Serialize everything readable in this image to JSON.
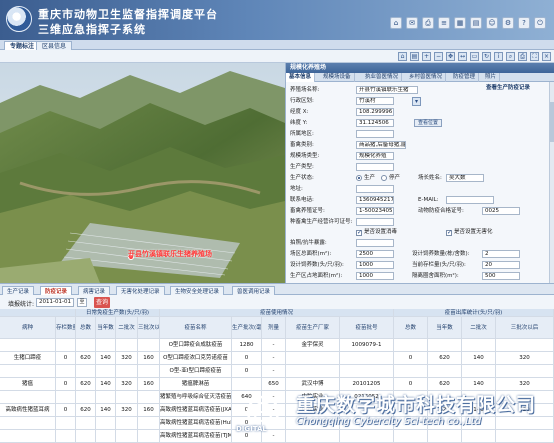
{
  "header": {
    "title_line1": "重庆市动物卫生监督指挥调度平台",
    "title_line2": "三维应急指挥子系统"
  },
  "tabs": [
    "专题标注",
    "区县信息"
  ],
  "panel": {
    "title": "规模化养殖场",
    "tabs": [
      "基本信息",
      "规模场设备",
      "执业兽医情况",
      "乡村兽医情况",
      "防疫管理",
      "照片"
    ],
    "link": "查看生产防疫记录",
    "fields": {
      "name_label": "养殖场名称:",
      "name_value": "开县竹溪镇联乐生猪",
      "village_label": "行政区划:",
      "village_value": "竹溪村",
      "lon_label": "经度 X:",
      "lon_value": "108.299996",
      "lat_label": "纬度 Y:",
      "lat_value": "31.124506",
      "town_label": "所属地区:",
      "town_value": "",
      "animal_label": "畜禽类别:",
      "animal_value": "商品猪,后备母猪,能",
      "scale_label": "规模场类型:",
      "scale_value": "规模化养殖",
      "prod_label": "生产类型:",
      "prod_value": "",
      "state_label": "生产状态:",
      "state_opt1": "生产",
      "state_opt2": "停产",
      "owner_label": "场长姓名:",
      "owner_value": "吴大数",
      "addr_label": "地址:",
      "addr_value": "",
      "phone_label": "联系电话:",
      "phone_value": "13609452175",
      "email_label": "E-MAIL:",
      "email_value": "",
      "license_label": "畜禽养殖证号:",
      "license_value": "1-5002340519",
      "permit_label": "动物防疫合格证号:",
      "permit_value": "0025",
      "sanitize_label": "种畜禽生产经营许可证号:",
      "sanitize_value": "",
      "chk1": "是否设置消毒",
      "chk2": "是否设置无害化",
      "direct_label": "拍照/抗牛暴露:",
      "direct_value": "",
      "area_label": "场区总面积(m²):",
      "area_value": "2500",
      "design_label": "设计饲养数量(栋/舍数):",
      "design_value": "2",
      "cap_label": "设计饲养数(头/只/羽):",
      "cap_value": "1000",
      "stock_label": "当前存栏量(头/只/羽):",
      "stock_value": "20",
      "bld_label": "生产区占地面积(m²):",
      "bld_value": "1000",
      "iso_label": "隔离圈舍面积(m²):",
      "iso_value": "500",
      "btn_locate": "查看位置"
    }
  },
  "map": {
    "label": "开县竹溪镇联乐生猪养殖场"
  },
  "lower_tabs": [
    "生产记录",
    "防疫记录",
    "病害记录",
    "无害化处理记录",
    "生物安全处理记录",
    "兽医调用记录"
  ],
  "filter": {
    "label": "填报统计:",
    "date": "2011-01-01",
    "select": "至",
    "button": "查询"
  },
  "table": {
    "group_headers": [
      "日常免疫生产数(头/只/羽)",
      "疫苗使用情况",
      "疫苗出库统计(头/只/羽)"
    ],
    "headers": [
      "病种",
      "存栏数量(头/只/羽)",
      "总数",
      "当年数",
      "二批次",
      "三批次以后",
      "疫苗名称",
      "生产批次(毫升)",
      "剂量",
      "疫苗生产厂家",
      "疫苗批号",
      "总数",
      "当年数",
      "二批次",
      "三批次以后"
    ],
    "rows": [
      {
        "disease": "",
        "stock": "",
        "total": "",
        "y1": "",
        "b2": "",
        "b3": "",
        "vaccine": "O型口蹄疫合成肽疫苗",
        "batch": "1280",
        "dose": "-",
        "maker": "金宇保灵",
        "lot": "1009079-1",
        "o1": "",
        "o2": "",
        "o3": "",
        "o4": ""
      },
      {
        "disease": "生猪口蹄疫",
        "stock": "0",
        "total": "620",
        "y1": "140",
        "b2": "320",
        "b3": "160",
        "vaccine": "O型口蹄疫浓口克劳诺疫苗",
        "batch": "0",
        "dose": "-",
        "maker": "",
        "lot": "",
        "o1": "0",
        "o2": "620",
        "o3": "140",
        "o4": "320"
      },
      {
        "disease": "",
        "stock": "",
        "total": "",
        "y1": "",
        "b2": "",
        "b3": "",
        "vaccine": "O型-亚I型口蹄疫疫苗",
        "batch": "0",
        "dose": "-",
        "maker": "",
        "lot": "",
        "o1": "",
        "o2": "",
        "o3": "",
        "o4": ""
      },
      {
        "disease": "猪瘟",
        "stock": "0",
        "total": "620",
        "y1": "140",
        "b2": "320",
        "b3": "160",
        "vaccine": "猪瘟脾淋苗",
        "batch": "",
        "dose": "650",
        "maker": "武汉中博",
        "lot": "20101205",
        "o1": "0",
        "o2": "620",
        "o3": "140",
        "o4": "320"
      },
      {
        "disease": "",
        "stock": "",
        "total": "",
        "y1": "",
        "b2": "",
        "b3": "",
        "vaccine": "猪繁殖与呼吸综合征灭活疫苗(NVDC-JXA1株)",
        "batch": "640",
        "dose": "-",
        "maker": "中牧实业",
        "lot": "0216052",
        "o1": "",
        "o2": "",
        "o3": "",
        "o4": ""
      },
      {
        "disease": "高致病性猪蓝耳病",
        "stock": "0",
        "total": "620",
        "y1": "140",
        "b2": "320",
        "b3": "160",
        "vaccine": "高致病性猪蓝耳病活疫苗(JXA1-R株)",
        "batch": "0",
        "dose": "-",
        "maker": "中牧实业",
        "lot": "",
        "o1": "0",
        "o2": "620",
        "o3": "140",
        "o4": "320"
      },
      {
        "disease": "",
        "stock": "",
        "total": "",
        "y1": "",
        "b2": "",
        "b3": "",
        "vaccine": "高致病性猪蓝耳病活疫苗(HuN4-F112株)",
        "batch": "0",
        "dose": "-",
        "maker": "",
        "lot": "",
        "o1": "",
        "o2": "",
        "o3": "",
        "o4": ""
      },
      {
        "disease": "",
        "stock": "",
        "total": "",
        "y1": "",
        "b2": "",
        "b3": "",
        "vaccine": "高致病性猪蓝耳病活疫苗(TJM-F92株)",
        "batch": "0",
        "dose": "-",
        "maker": "",
        "lot": "",
        "o1": "",
        "o2": "",
        "o3": "",
        "o4": ""
      }
    ]
  },
  "watermark": {
    "cn": "重庆数字城市科技有限公司",
    "en": "Chongqing Cybercity Sci-tech co.,Ltd",
    "logo": "DIGITAL"
  }
}
